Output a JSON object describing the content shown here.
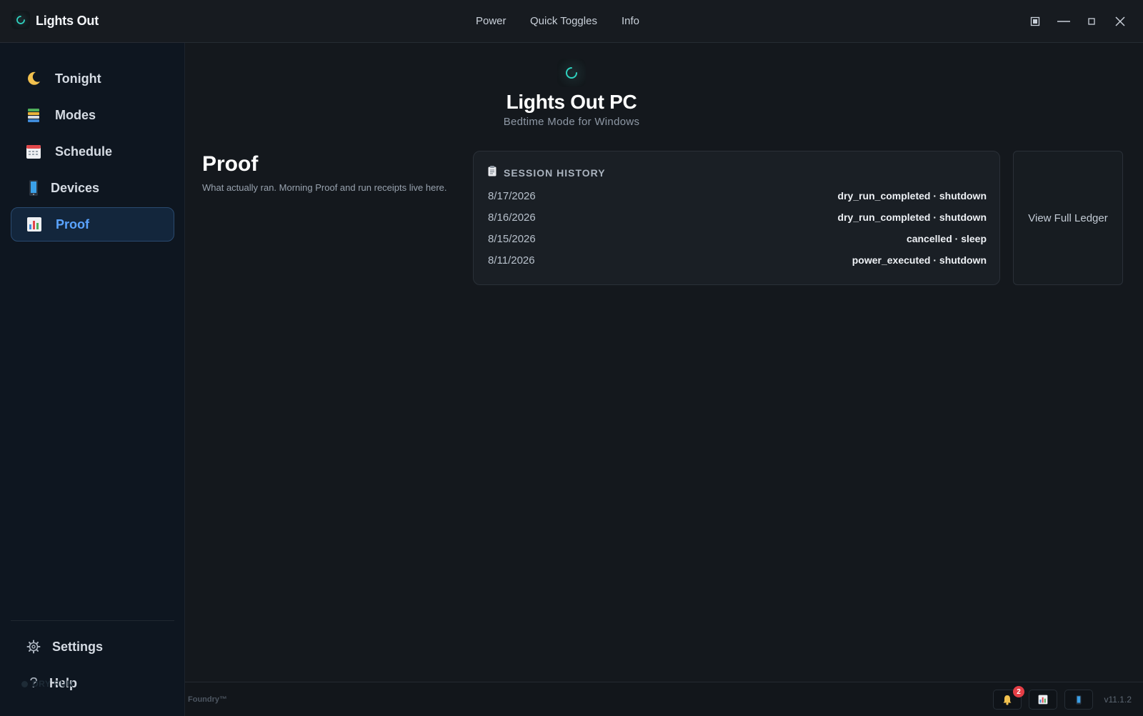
{
  "app": {
    "title": "Lights Out"
  },
  "top_menu": {
    "items": [
      "Power",
      "Quick Toggles",
      "Info"
    ]
  },
  "sidebar": {
    "items": [
      {
        "label": "Tonight",
        "icon": "moon-icon"
      },
      {
        "label": "Modes",
        "icon": "stack-icon"
      },
      {
        "label": "Schedule",
        "icon": "calendar-icon"
      },
      {
        "label": "Devices",
        "icon": "phone-icon"
      },
      {
        "label": "Proof",
        "icon": "bar-chart-icon",
        "active": true
      }
    ],
    "bottom": [
      {
        "label": "Settings",
        "icon": "gear-icon"
      },
      {
        "label": "Help",
        "icon": "question-icon"
      }
    ],
    "dry_run_label": "DRY RUN"
  },
  "hero": {
    "title": "Lights Out PC",
    "subtitle": "Bedtime Mode for Windows"
  },
  "page": {
    "title": "Proof",
    "description": "What actually ran. Morning Proof and run receipts live here."
  },
  "history": {
    "heading": "SESSION HISTORY",
    "rows": [
      {
        "date": "8/17/2026",
        "status": "dry_run_completed · shutdown"
      },
      {
        "date": "8/16/2026",
        "status": "dry_run_completed · shutdown"
      },
      {
        "date": "8/15/2026",
        "status": "cancelled · sleep"
      },
      {
        "date": "8/11/2026",
        "status": "power_executed · shutdown"
      }
    ],
    "ledger_button": "View Full Ledger"
  },
  "statusbar": {
    "foundry": "Foundry™",
    "notification_count": "2",
    "version": "v11.1.2"
  },
  "colors": {
    "accent": "#5aa3ff",
    "logo_ring": "#2fd3c0",
    "badge": "#e53e46"
  }
}
